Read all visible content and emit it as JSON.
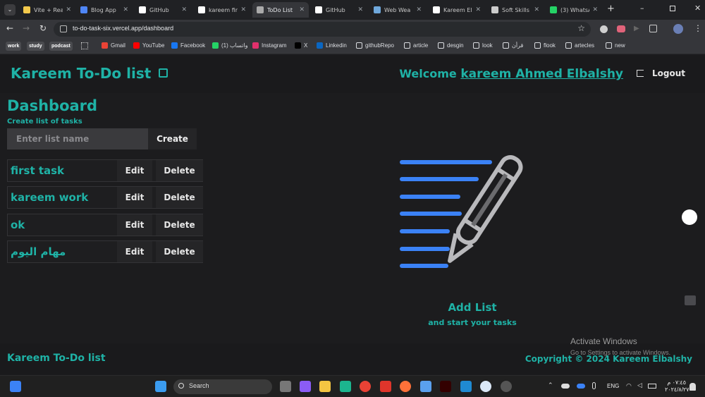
{
  "browser": {
    "tabs": [
      {
        "label": "Vite + Rea",
        "color": "#f2c94c"
      },
      {
        "label": "Blog App",
        "color": "#4f86f7"
      },
      {
        "label": "GitHub",
        "color": "#ffffff"
      },
      {
        "label": "kareem fir",
        "color": "#ffffff"
      },
      {
        "label": "ToDo List",
        "color": "#aaaaaa"
      },
      {
        "label": "GitHub",
        "color": "#ffffff"
      },
      {
        "label": "Web Wea",
        "color": "#6fa8dc"
      },
      {
        "label": "Kareem El",
        "color": "#ffffff"
      },
      {
        "label": "Soft Skills",
        "color": "#cccccc"
      },
      {
        "label": "(3) WhatsA",
        "color": "#25d366"
      }
    ],
    "url": "to-do-task-six.vercel.app/dashboard",
    "bookmarks": [
      {
        "label": "work",
        "chip": true
      },
      {
        "label": "study",
        "chip": true
      },
      {
        "label": "podcast",
        "chip": true
      },
      {
        "label": "Gmail",
        "icon": "gmail-icon",
        "color": "#ea4335"
      },
      {
        "label": "YouTube",
        "icon": "youtube-icon",
        "color": "#ff0000"
      },
      {
        "label": "Facebook",
        "icon": "facebook-icon",
        "color": "#1877f2"
      },
      {
        "label": "واتساب (1)",
        "icon": "whatsapp-icon",
        "color": "#25d366"
      },
      {
        "label": "Instagram",
        "icon": "instagram-icon",
        "color": "#e1306c"
      },
      {
        "label": "X",
        "icon": "x-icon",
        "color": "#000000"
      },
      {
        "label": "Linkedin",
        "icon": "linkedin-icon",
        "color": "#0a66c2"
      },
      {
        "label": "githubRepo",
        "icon": "folder-icon",
        "color": "#dadce0"
      },
      {
        "label": "article",
        "icon": "folder-icon",
        "color": "#dadce0"
      },
      {
        "label": "desgin",
        "icon": "folder-icon",
        "color": "#dadce0"
      },
      {
        "label": "look",
        "icon": "folder-icon",
        "color": "#dadce0"
      },
      {
        "label": "قرأن",
        "icon": "folder-icon",
        "color": "#dadce0"
      },
      {
        "label": "flook",
        "icon": "folder-icon",
        "color": "#dadce0"
      },
      {
        "label": "artecles",
        "icon": "folder-icon",
        "color": "#dadce0"
      },
      {
        "label": "new",
        "icon": "folder-icon",
        "color": "#dadce0"
      }
    ]
  },
  "app": {
    "brand": "Kareem To-Do list",
    "welcome_prefix": "Welcome",
    "username": "kareem Ahmed Elbalshy",
    "logout_label": "Logout",
    "dashboard_title": "Dashboard",
    "create_label": "Create list of tasks",
    "input_placeholder": "Enter list name",
    "create_button": "Create",
    "edit_label": "Edit",
    "delete_label": "Delete",
    "tasks": [
      "first task",
      "kareem work",
      "ok",
      "مهام اليوم"
    ],
    "add_list_title": "Add List",
    "add_list_sub": "and start your tasks",
    "footer_brand": "Kareem To-Do list",
    "copyright": "Copyright © 2024 Kareem Elbalshy",
    "accent_color": "#1fb2a6"
  },
  "os": {
    "watermark_title": "Activate Windows",
    "watermark_sub": "Go to Settings to activate Windows.",
    "search_label": "Search",
    "language": "ENG",
    "time": "٠٧:٤٥ م",
    "date": "٢٠٢٤/٨/٢٧"
  }
}
